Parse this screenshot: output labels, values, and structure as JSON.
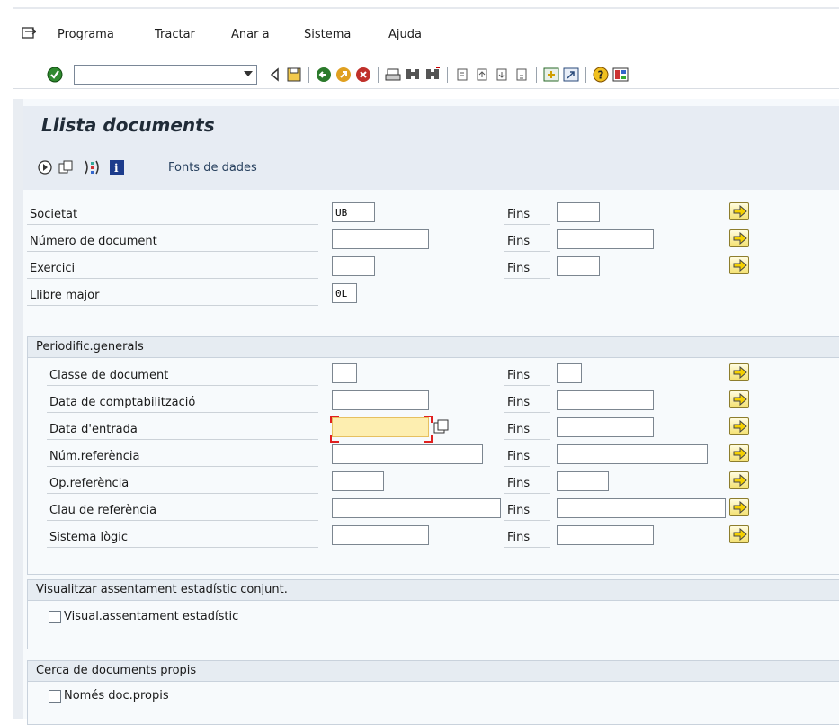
{
  "menu": [
    {
      "label": "Programa"
    },
    {
      "label": "Tractar"
    },
    {
      "label": "Anar a"
    },
    {
      "label": "Sistema"
    },
    {
      "label": "Ajuda"
    }
  ],
  "toolbar": {
    "command_value": ""
  },
  "screen": {
    "title": "Llista documents",
    "app_button": "Fonts de dades"
  },
  "fields": [
    {
      "label": "Societat",
      "value": "UB",
      "to_label": "Fins",
      "to_value": ""
    },
    {
      "label": "Número de document",
      "value": "",
      "to_label": "Fins",
      "to_value": ""
    },
    {
      "label": "Exercici",
      "value": "",
      "to_label": "Fins",
      "to_value": ""
    },
    {
      "label": "Llibre major",
      "value": "0L"
    }
  ],
  "period": {
    "title": "Periodific.generals",
    "fields": [
      {
        "label": "Classe de document",
        "value": "",
        "to_label": "Fins",
        "to_value": ""
      },
      {
        "label": "Data de comptabilització",
        "value": "",
        "to_label": "Fins",
        "to_value": ""
      },
      {
        "label": "Data d'entrada",
        "value": "",
        "to_label": "Fins",
        "to_value": ""
      },
      {
        "label": "Núm.referència",
        "value": "",
        "to_label": "Fins",
        "to_value": ""
      },
      {
        "label": "Op.referència",
        "value": "",
        "to_label": "Fins",
        "to_value": ""
      },
      {
        "label": "Clau de referència",
        "value": "",
        "to_label": "Fins",
        "to_value": ""
      },
      {
        "label": "Sistema lògic",
        "value": "",
        "to_label": "Fins",
        "to_value": ""
      }
    ]
  },
  "stat": {
    "title": "Visualitzar assentament estadístic conjunt.",
    "checkbox_label": "Visual.assentament estadístic",
    "checked": false
  },
  "own": {
    "title": "Cerca de documents propis",
    "checkbox_label": "Només doc.propis",
    "checked": false
  },
  "colors": {
    "accent": "#f4e170",
    "focus": "#e02020",
    "header": "#e7ecf3"
  }
}
